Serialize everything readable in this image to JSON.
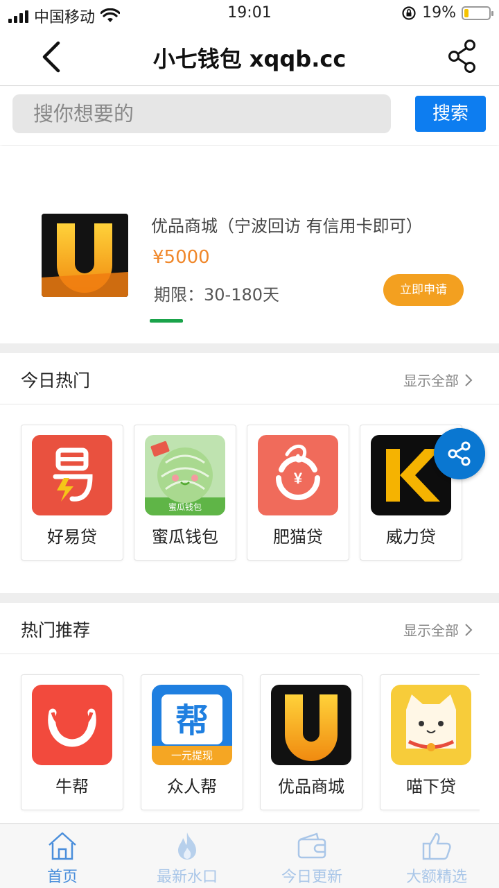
{
  "status_bar": {
    "carrier": "中国移动",
    "time": "19:01",
    "battery": "19%",
    "battery_level": 0.19
  },
  "nav": {
    "title": "小七钱包 xqqb.cc",
    "back_icon": "chevron-left-icon",
    "share_icon": "share-icon"
  },
  "search": {
    "placeholder": "搜你想要的",
    "button": "搜索"
  },
  "banner": {
    "title": "优品商城（宁波回访 有信用卡即可）",
    "amount": "¥5000",
    "term": "期限：30-180天",
    "apply": "立即申请"
  },
  "today_hot": {
    "title": "今日热门",
    "more": "显示全部",
    "items": [
      {
        "name": "好易贷",
        "icon": "haoyidai-logo",
        "color": "#e9513f"
      },
      {
        "name": "蜜瓜钱包",
        "icon": "melon-wallet-logo",
        "color": "#7dc96c"
      },
      {
        "name": "肥猫贷",
        "icon": "feimao-logo",
        "color": "#f06b5b"
      },
      {
        "name": "威力贷",
        "icon": "weili-logo",
        "color": "#f5b301"
      }
    ]
  },
  "hot_recommend": {
    "title": "热门推荐",
    "more": "显示全部",
    "items": [
      {
        "name": "牛帮",
        "icon": "niubang-logo",
        "color": "#f24a3d"
      },
      {
        "name": "众人帮",
        "icon": "zhongrenbang-logo",
        "color": "#1f7fe0",
        "badge": "一元提现"
      },
      {
        "name": "优品商城",
        "icon": "youpin-logo",
        "color": "#f5a11a"
      },
      {
        "name": "喵下贷",
        "icon": "cat-logo",
        "color": "#f7cc3a"
      }
    ]
  },
  "tabs": [
    {
      "label": "首页",
      "icon": "home-icon",
      "active": true
    },
    {
      "label": "最新水口",
      "icon": "flame-icon",
      "active": false
    },
    {
      "label": "今日更新",
      "icon": "wallet-icon",
      "active": false
    },
    {
      "label": "大额精选",
      "icon": "thumbs-up-icon",
      "active": false
    }
  ]
}
